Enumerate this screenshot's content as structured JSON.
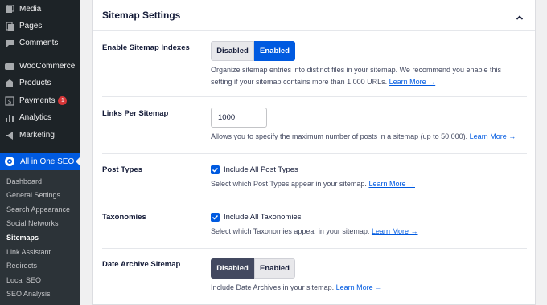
{
  "sidebar": {
    "items": [
      {
        "label": "Media",
        "icon": "media-icon"
      },
      {
        "label": "Pages",
        "icon": "pages-icon"
      },
      {
        "label": "Comments",
        "icon": "comments-icon"
      },
      {
        "label": "WooCommerce",
        "icon": "woocommerce-icon"
      },
      {
        "label": "Products",
        "icon": "products-icon"
      },
      {
        "label": "Payments",
        "icon": "payments-icon",
        "badge": "1"
      },
      {
        "label": "Analytics",
        "icon": "analytics-icon"
      },
      {
        "label": "Marketing",
        "icon": "marketing-icon"
      }
    ],
    "active": {
      "label": "All in One SEO",
      "icon": "aioseo-icon"
    },
    "submenu": [
      {
        "label": "Dashboard"
      },
      {
        "label": "General Settings"
      },
      {
        "label": "Search Appearance"
      },
      {
        "label": "Social Networks"
      },
      {
        "label": "Sitemaps",
        "current": true
      },
      {
        "label": "Link Assistant"
      },
      {
        "label": "Redirects"
      },
      {
        "label": "Local SEO"
      },
      {
        "label": "SEO Analysis"
      }
    ]
  },
  "panel": {
    "title": "Sitemap Settings",
    "rows": {
      "enable_indexes": {
        "label": "Enable Sitemap Indexes",
        "options": [
          "Disabled",
          "Enabled"
        ],
        "selected": "Enabled",
        "desc_line1": "Organize sitemap entries into distinct files in your sitemap. We recommend you enable this",
        "desc_line2": "setting if your sitemap contains more than 1,000 URLs.",
        "link": "Learn More →"
      },
      "links_per_sitemap": {
        "label": "Links Per Sitemap",
        "value": "1000",
        "desc": "Allows you to specify the maximum number of posts in a sitemap (up to 50,000).",
        "link": "Learn More →"
      },
      "post_types": {
        "label": "Post Types",
        "checkbox_label": "Include All Post Types",
        "checked": true,
        "desc": "Select which Post Types appear in your sitemap.",
        "link": "Learn More →"
      },
      "taxonomies": {
        "label": "Taxonomies",
        "checkbox_label": "Include All Taxonomies",
        "checked": true,
        "desc": "Select which Taxonomies appear in your sitemap.",
        "link": "Learn More →"
      },
      "date_archive": {
        "label": "Date Archive Sitemap",
        "options": [
          "Disabled",
          "Enabled"
        ],
        "selected": "Disabled",
        "desc": "Include Date Archives in your sitemap.",
        "link": "Learn More →"
      }
    }
  },
  "colors": {
    "accent": "#005ae0",
    "sidebar_bg": "#1d2327",
    "badge": "#d63638",
    "dark_toggle": "#434960"
  }
}
